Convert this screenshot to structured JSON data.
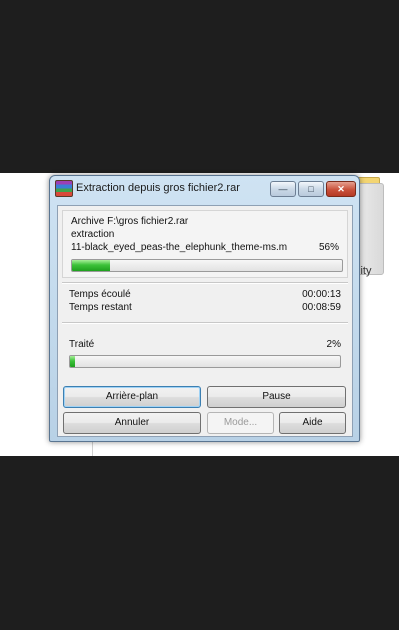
{
  "window": {
    "title": "Extraction depuis gros fichier2.rar",
    "min_glyph": "—",
    "max_glyph": "□",
    "close_glyph": "✕"
  },
  "background": {
    "partial_text": "lity"
  },
  "archive": {
    "archive_line": "Archive F:\\gros fichier2.rar",
    "operation": "extraction",
    "current_file": "11-black_eyed_peas-the_elephunk_theme-ms.m",
    "file_percent": "56%"
  },
  "times": {
    "elapsed_label": "Temps écoulé",
    "elapsed_value": "00:00:13",
    "remaining_label": "Temps restant",
    "remaining_value": "00:08:59"
  },
  "processed": {
    "label": "Traité",
    "percent": "2%"
  },
  "progress": {
    "file_fraction": 0.14,
    "total_fraction": 0.02
  },
  "buttons": {
    "background": "Arrière-plan",
    "pause": "Pause",
    "cancel": "Annuler",
    "mode": "Mode...",
    "help": "Aide"
  },
  "colors": {
    "progress_green": "#2fb52c",
    "accent": "#3c7fb1"
  },
  "icons": {
    "app": "winrar-icon"
  }
}
